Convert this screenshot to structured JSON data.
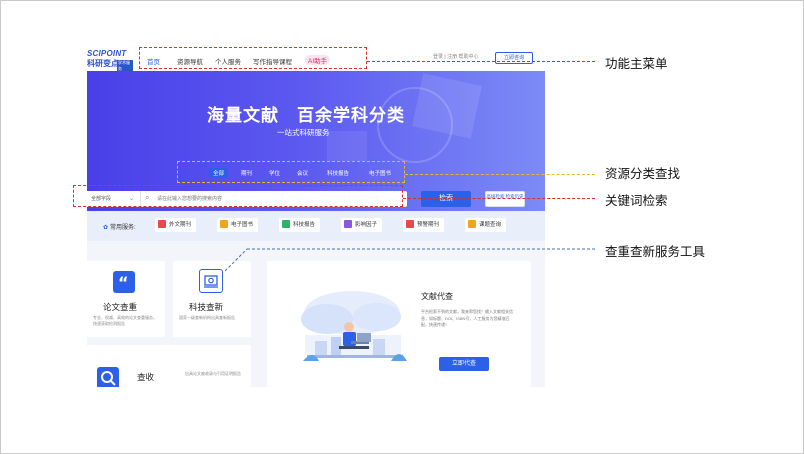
{
  "header": {
    "logo_line1": "SCIPOINT",
    "logo_line2": "科研变点",
    "logo_tag": "学术服务",
    "nav": [
      {
        "label": "首页",
        "active": true
      },
      {
        "label": "资源导航"
      },
      {
        "label": "个人服务"
      },
      {
        "label": "写作指导课程"
      },
      {
        "label": "AI助手",
        "badge": true
      }
    ],
    "right_links": "登录 | 注册 帮助中心",
    "right_button": "立即咨询"
  },
  "banner": {
    "title": "海量文献　百余学科分类",
    "subtitle": "一站式科研服务",
    "categories": [
      "全部",
      "期刊",
      "学位",
      "会议",
      "科技报告",
      "电子图书"
    ],
    "selected_category": "全部",
    "search_scope": "全部字段",
    "search_placeholder": "请在此输入您想要的搜索内容",
    "search_button": "检索",
    "advanced_button": "高级检索 检索历史"
  },
  "services": {
    "label": "常用服务:",
    "items": [
      {
        "label": "外文期刊",
        "icon": "journal-icon",
        "color": "#e8484e"
      },
      {
        "label": "电子图书",
        "icon": "book-icon",
        "color": "#f0a51e"
      },
      {
        "label": "科技报告",
        "icon": "report-icon",
        "color": "#2bb36a"
      },
      {
        "label": "影响因子",
        "icon": "factor-icon",
        "color": "#8a56e2"
      },
      {
        "label": "预警期刊",
        "icon": "warning-icon",
        "color": "#e8484e"
      },
      {
        "label": "课题查询",
        "icon": "topic-icon",
        "color": "#f0a51e"
      }
    ]
  },
  "cards": {
    "paper_check": {
      "title": "论文查重",
      "desc": "专业、权威、高效的论文查重服务，快速获取检测报告"
    },
    "novelty": {
      "title": "科技查新",
      "desc": "国家一级查新机构出具查新报告"
    },
    "cite_check": {
      "title": "查收",
      "desc": "出具论文被收录与引用证明报告"
    },
    "doc_delivery": {
      "title": "文献代查",
      "desc": "平台检索不到的文献，我来帮您找！输入文献相关信息，如标题、DOI、ISBN号，人工服务为您精准匹配，快速传递！",
      "button": "立即代查"
    }
  },
  "annotations": {
    "main_menu": "功能主菜单",
    "category_search": "资源分类查找",
    "keyword_search": "关键词检索",
    "tools": "查重查新服务工具"
  }
}
